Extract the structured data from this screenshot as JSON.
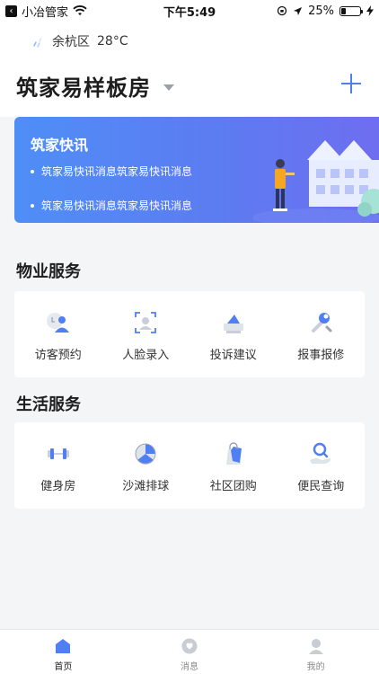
{
  "status_bar": {
    "app_name": "小冶管家",
    "time": "下午5:49",
    "battery": "25%",
    "battery_level": 0.25
  },
  "weather": {
    "district": "余杭区",
    "temperature": "28°C"
  },
  "header": {
    "title": "筑家易样板房"
  },
  "news": {
    "title": "筑家快讯",
    "items": [
      "筑家易快讯消息筑家易快讯消息",
      "筑家易快讯消息筑家易快讯消息"
    ]
  },
  "property_services": {
    "title": "物业服务",
    "items": [
      {
        "label": "访客预约",
        "icon": "visitor-icon"
      },
      {
        "label": "人脸录入",
        "icon": "face-scan-icon"
      },
      {
        "label": "投诉建议",
        "icon": "complaint-icon"
      },
      {
        "label": "报事报修",
        "icon": "repair-icon"
      }
    ]
  },
  "life_services": {
    "title": "生活服务",
    "items": [
      {
        "label": "健身房",
        "icon": "dumbbell-icon"
      },
      {
        "label": "沙滩排球",
        "icon": "volleyball-icon"
      },
      {
        "label": "社区团购",
        "icon": "shopping-bag-icon"
      },
      {
        "label": "便民查询",
        "icon": "search-hand-icon"
      }
    ]
  },
  "tabs": [
    {
      "label": "首页",
      "icon": "home-icon",
      "active": true
    },
    {
      "label": "消息",
      "icon": "message-icon",
      "active": false
    },
    {
      "label": "我的",
      "icon": "profile-icon",
      "active": false
    }
  ],
  "colors": {
    "accent": "#4f7ef5",
    "banner_start": "#4f8ef7",
    "banner_end": "#6e6ef0"
  }
}
